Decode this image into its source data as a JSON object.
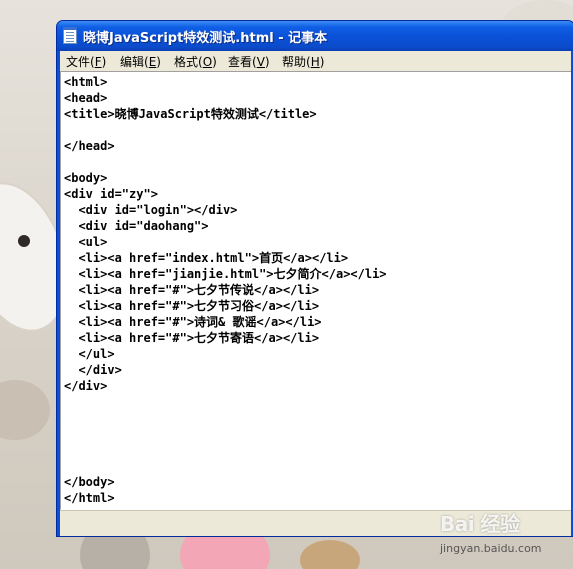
{
  "window": {
    "title": "晓博JavaScript特效测试.html - 记事本"
  },
  "menubar": {
    "items": [
      {
        "label": "文件(F)",
        "text": "文件(",
        "key": "F",
        "end": ")"
      },
      {
        "label": "编辑(E)",
        "text": "编辑(",
        "key": "E",
        "end": ")"
      },
      {
        "label": "格式(O)",
        "text": "格式(",
        "key": "O",
        "end": ")"
      },
      {
        "label": "查看(V)",
        "text": "查看(",
        "key": "V",
        "end": ")"
      },
      {
        "label": "帮助(H)",
        "text": "帮助(",
        "key": "H",
        "end": ")"
      }
    ]
  },
  "editor": {
    "content": "<html>\n<head>\n<title>晓博JavaScript特效测试</title>\n\n</head>\n\n<body>\n<div id=\"zy\">\n  <div id=\"login\"></div>\n  <div id=\"daohang\">\n  <ul>\n  <li><a href=\"index.html\">首页</a></li>\n  <li><a href=\"jianjie.html\">七夕简介</a></li>\n  <li><a href=\"#\">七夕节传说</a></li>\n  <li><a href=\"#\">七夕节习俗</a></li>\n  <li><a href=\"#\">诗词& 歌谣</a></li>\n  <li><a href=\"#\">七夕节寄语</a></li>\n  </ul>\n  </div>\n</div>\n\n\n\n\n\n</body>\n</html>"
  },
  "watermark": {
    "logo": "Bai 经验",
    "url": "jingyan.baidu.com"
  }
}
